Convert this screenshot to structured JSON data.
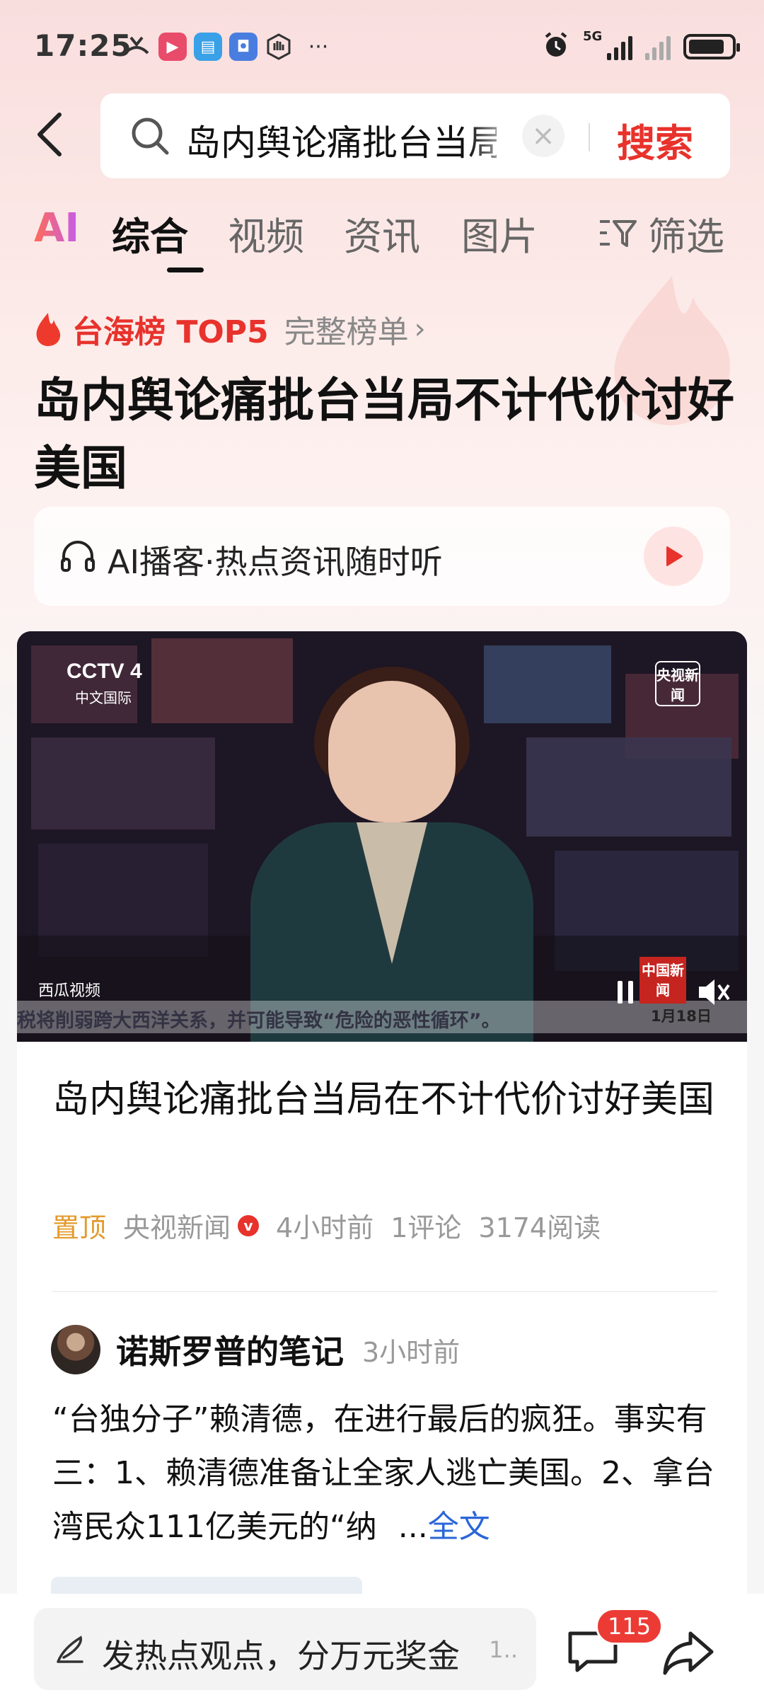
{
  "status_bar": {
    "time": "17:25",
    "more": "···",
    "network": "5G"
  },
  "search": {
    "query": "岛内舆论痛批台当局不计代价讨好美国",
    "clear_icon": "×",
    "button": "搜索"
  },
  "tabs": {
    "ai": "AI",
    "items": [
      "综合",
      "视频",
      "资讯",
      "图片"
    ],
    "filter": "筛选"
  },
  "hot_list": {
    "title": "台海榜 TOP5",
    "full_list": "完整榜单",
    "chevron": "›",
    "headline": "岛内舆论痛批台当局不计代价讨好美国"
  },
  "podcast": {
    "label": "AI播客·热点资讯随时听"
  },
  "video": {
    "channel_logo": "CCTV 4",
    "channel_sub": "中文国际",
    "corner_badge": "央视新闻",
    "source_watermark": "西瓜视频",
    "ticker": "税将削弱跨大西洋关系，并可能导致“危险的恶性循环”。",
    "news_badge": "中国新闻",
    "date": "1月18日"
  },
  "article": {
    "title": "岛内舆论痛批台当局在不计代价讨好美国",
    "pinned": "置顶",
    "source": "央视新闻",
    "verified": "v",
    "time": "4小时前",
    "comments": "1评论",
    "reads": "3174阅读"
  },
  "post": {
    "author": "诺斯罗普的笔记",
    "time": "3小时前",
    "text": "“台独分子”赖清德，在进行最后的疯狂。事实有三：1、赖清德准备让全家人逃亡美国。2、拿台湾民众111亿美元的“纳",
    "ellipsis": "...",
    "more": "全文"
  },
  "bottom_bar": {
    "comment_prompt": "发热点观点，分万元奖金",
    "comment_prompt_more": "1..",
    "comment_count": "115"
  },
  "colors": {
    "accent_red": "#e8322c",
    "pin_orange": "#e39a2c",
    "link_blue": "#2b66d9"
  }
}
